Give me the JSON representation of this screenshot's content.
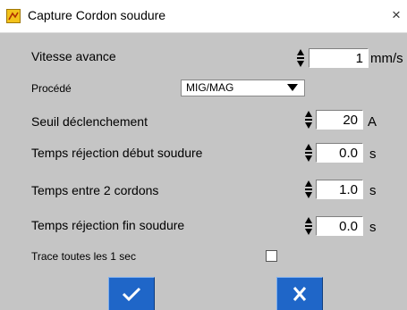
{
  "window": {
    "title": "Capture Cordon soudure",
    "close_glyph": "×",
    "icon": "app-icon",
    "close_icon": "close-icon"
  },
  "fields": {
    "vitesse": {
      "label": "Vitesse avance",
      "value": "1",
      "unit": "mm/s"
    },
    "procede": {
      "label": "Procédé",
      "selected": "MIG/MAG"
    },
    "seuil": {
      "label": "Seuil déclenchement",
      "value": "20",
      "unit": "A"
    },
    "rej_debut": {
      "label": "Temps réjection début soudure",
      "value": "0.0",
      "unit": "s"
    },
    "entre_cordons": {
      "label": "Temps entre 2 cordons",
      "value": "1.0",
      "unit": "s"
    },
    "rej_fin": {
      "label": "Temps réjection fin soudure",
      "value": "0.0",
      "unit": "s"
    },
    "trace": {
      "label": "Trace toutes les 1 sec",
      "checked": false
    }
  },
  "buttons": {
    "ok_icon": "check-icon",
    "cancel_icon": "x-icon"
  },
  "colors": {
    "background": "#c5c5c5",
    "button": "#1f66c8",
    "icon_frame": "#d4a017"
  }
}
